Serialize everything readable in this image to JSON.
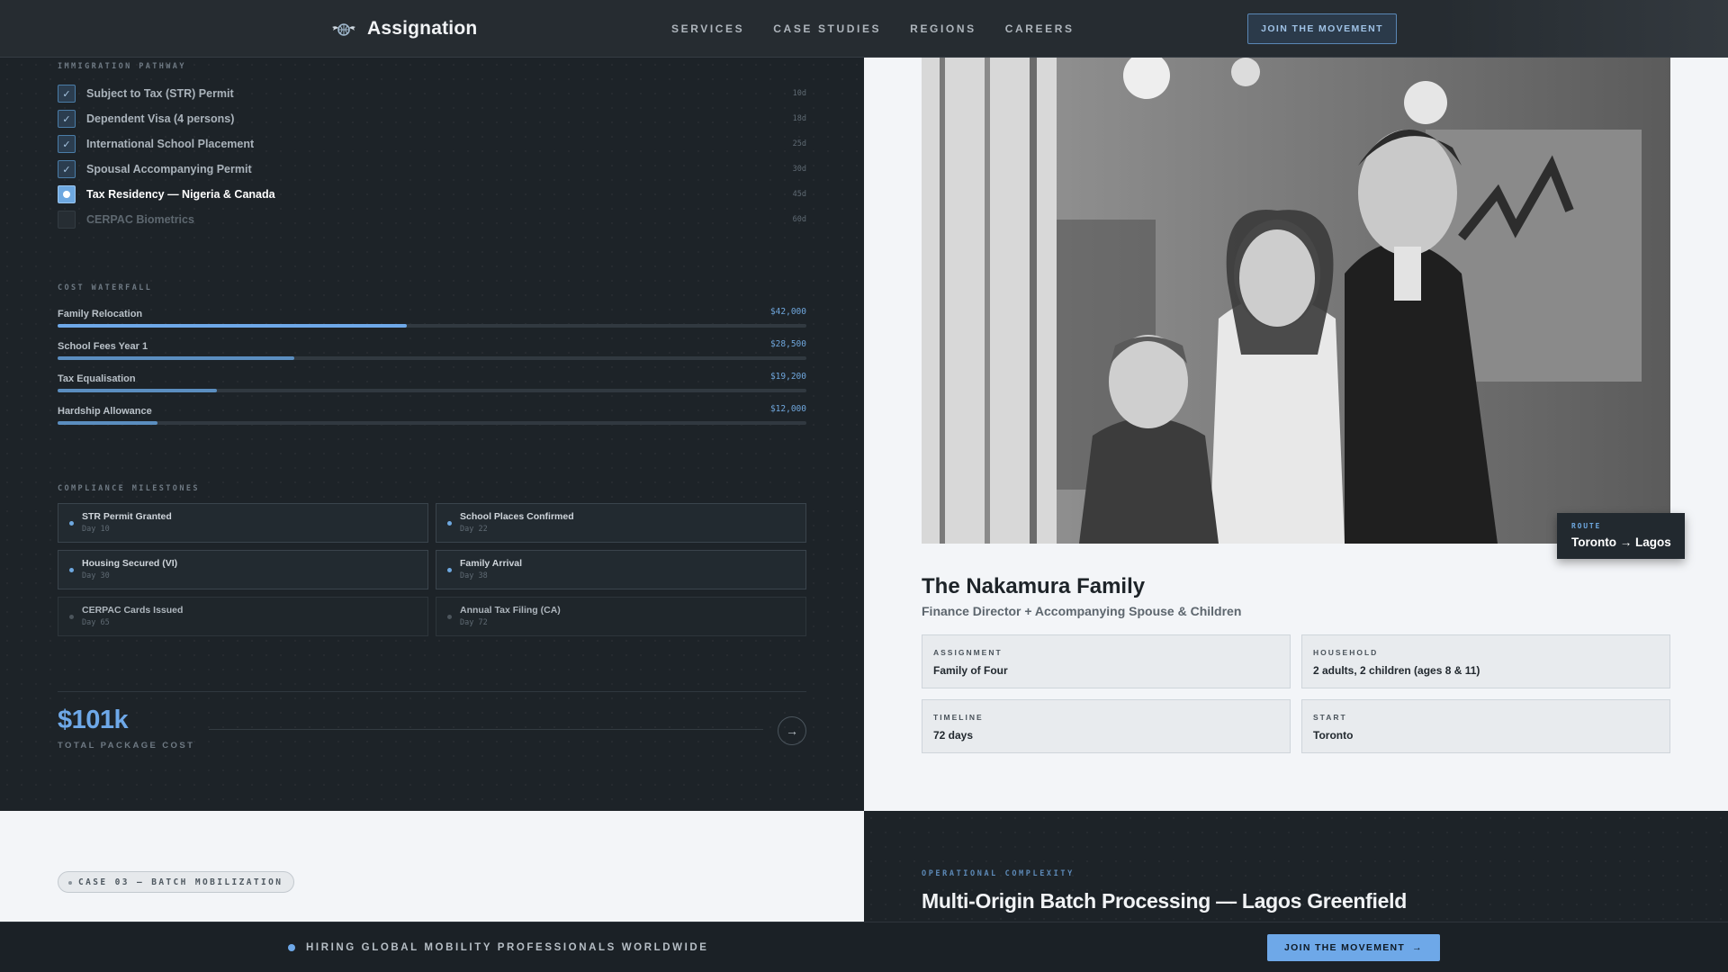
{
  "header": {
    "brand": "Assignation",
    "brand_icon": "globe-wings-icon",
    "nav": [
      "SERVICES",
      "CASE STUDIES",
      "REGIONS",
      "CAREERS"
    ],
    "cta": "JOIN THE MOVEMENT"
  },
  "pathway": {
    "label": "IMMIGRATION PATHWAY",
    "items": [
      {
        "label": "Subject to Tax (STR) Permit",
        "days": "10d",
        "status": "done"
      },
      {
        "label": "Dependent Visa (4 persons)",
        "days": "18d",
        "status": "done"
      },
      {
        "label": "International School Placement",
        "days": "25d",
        "status": "done"
      },
      {
        "label": "Spousal Accompanying Permit",
        "days": "30d",
        "status": "done"
      },
      {
        "label": "Tax Residency — Nigeria & Canada",
        "days": "45d",
        "status": "active"
      },
      {
        "label": "CERPAC Biometrics",
        "days": "60d",
        "status": "pending"
      }
    ]
  },
  "costs": {
    "label": "COST WATERFALL",
    "items": [
      {
        "label": "Family Relocation",
        "amount": "$42,000",
        "value": 42000
      },
      {
        "label": "School Fees Year 1",
        "amount": "$28,500",
        "value": 28500
      },
      {
        "label": "Tax Equalisation",
        "amount": "$19,200",
        "value": 19200
      },
      {
        "label": "Hardship Allowance",
        "amount": "$12,000",
        "value": 12000
      }
    ],
    "scale_max": 90000
  },
  "milestones": {
    "label": "COMPLIANCE MILESTONES",
    "items": [
      {
        "title": "STR Permit Granted",
        "day": "Day 10",
        "done": true
      },
      {
        "title": "School Places Confirmed",
        "day": "Day 22",
        "done": true
      },
      {
        "title": "Housing Secured (VI)",
        "day": "Day 30",
        "done": true
      },
      {
        "title": "Family Arrival",
        "day": "Day 38",
        "done": true
      },
      {
        "title": "CERPAC Cards Issued",
        "day": "Day 65",
        "done": false
      },
      {
        "title": "Annual Tax Filing (CA)",
        "day": "Day 72",
        "done": false
      }
    ]
  },
  "total": {
    "value": "$101k",
    "label": "TOTAL PACKAGE COST"
  },
  "case": {
    "route_label": "ROUTE",
    "route": "Toronto → Lagos",
    "title": "The Nakamura Family",
    "subtitle": "Finance Director + Accompanying Spouse & Children",
    "info": [
      {
        "label": "ASSIGNMENT",
        "value": "Family of Four"
      },
      {
        "label": "HOUSEHOLD",
        "value": "2 adults, 2 children (ages 8 & 11)"
      },
      {
        "label": "TIMELINE",
        "value": "72 days"
      },
      {
        "label": "START",
        "value": "Toronto"
      }
    ]
  },
  "next_case": {
    "pill": "CASE 03 — BATCH MOBILIZATION",
    "eyebrow": "OPERATIONAL COMPLEXITY",
    "title": "Multi-Origin Batch Processing — Lagos Greenfield"
  },
  "banner": {
    "text": "HIRING GLOBAL MOBILITY PROFESSIONALS WORLDWIDE",
    "cta": "JOIN THE MOVEMENT"
  },
  "colors": {
    "accent": "#6ea8e8",
    "dark": "#1d2328",
    "light": "#f3f5f8"
  }
}
